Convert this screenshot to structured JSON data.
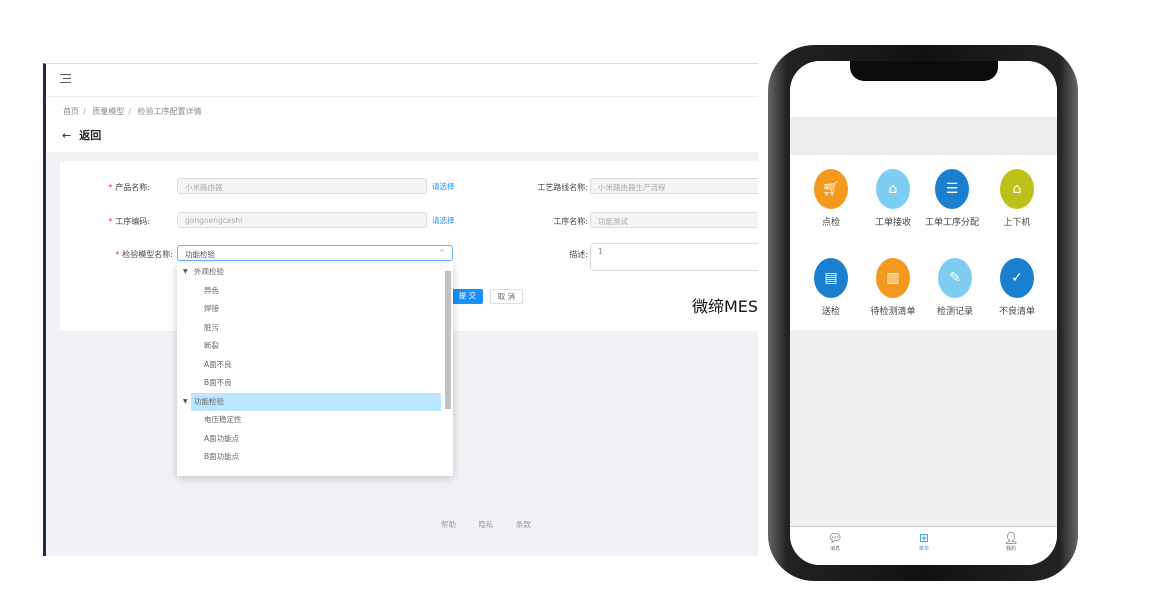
{
  "web": {
    "breadcrumb": [
      "首页",
      "质量模型",
      "检验工序配置详情"
    ],
    "back_label": "返回",
    "form": {
      "product_name": {
        "label": "产品名称:",
        "value": "小米路由器",
        "link": "请选择"
      },
      "process_code": {
        "label": "工序编码:",
        "value": "gongnengceshi",
        "link": "请选择"
      },
      "model_name": {
        "label": "检验模型名称:",
        "value": "功能检验"
      },
      "route_name": {
        "label": "工艺路线名称:",
        "value": "小米路由器生产流程"
      },
      "process_name": {
        "label": "工序名称:",
        "value": "功能测试"
      },
      "description": {
        "label": "描述:",
        "value": "1"
      },
      "submit": "提 交",
      "cancel": "取 消"
    },
    "dropdown": [
      {
        "label": "外观检验",
        "group": true
      },
      {
        "label": "异色"
      },
      {
        "label": "焊接"
      },
      {
        "label": "脏污"
      },
      {
        "label": "断裂"
      },
      {
        "label": "A面不良"
      },
      {
        "label": "B面不良"
      },
      {
        "label": "功能检验",
        "group": true,
        "selected": true
      },
      {
        "label": "电压稳定性"
      },
      {
        "label": "A面功能点"
      },
      {
        "label": "B面功能点"
      }
    ],
    "footer": [
      "帮助",
      "隐私",
      "条款"
    ]
  },
  "watermark": "微缔MES",
  "phone": {
    "apps": [
      {
        "label": "点检",
        "color": "#f39a1e",
        "icon": "cart-icon"
      },
      {
        "label": "工单接收",
        "color": "#7fcdf2",
        "icon": "home-in-icon"
      },
      {
        "label": "工单工序分配",
        "color": "#1a7fcf",
        "icon": "sliders-icon"
      },
      {
        "label": "上下机",
        "color": "#bcc21a",
        "icon": "home-return-icon"
      },
      {
        "label": "送检",
        "color": "#1a7fcf",
        "icon": "list-icon"
      },
      {
        "label": "待检测清单",
        "color": "#f39a1e",
        "icon": "bar-chart-icon"
      },
      {
        "label": "检测记录",
        "color": "#7fcdf2",
        "icon": "wrench-icon"
      },
      {
        "label": "不良清单",
        "color": "#1a7fcf",
        "icon": "check-circle-icon"
      }
    ],
    "tabs": [
      {
        "label": "消息",
        "icon": "chat-icon"
      },
      {
        "label": "菜单",
        "icon": "grid-icon",
        "active": true
      },
      {
        "label": "我的",
        "icon": "user-icon"
      }
    ],
    "accent": "#3aa0d8"
  }
}
